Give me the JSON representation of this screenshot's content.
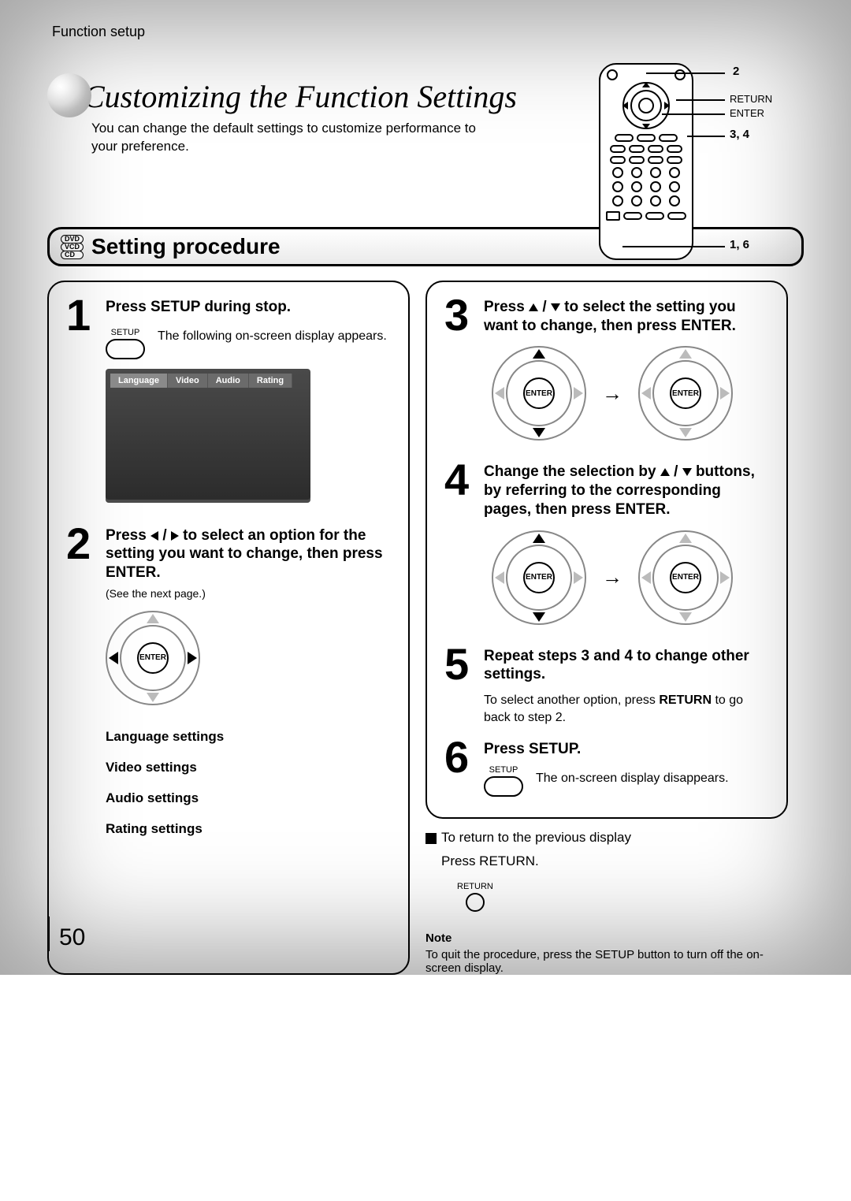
{
  "header": "Function setup",
  "title": "Customizing the Function Settings",
  "intro": "You can change the default settings to customize performance to your preference.",
  "remote_labels": {
    "l2": "2",
    "return": "RETURN",
    "enter": "ENTER",
    "l34": "3, 4",
    "l16": "1, 6"
  },
  "disc_badges": [
    "DVD",
    "VCD",
    "CD"
  ],
  "proc_title": "Setting procedure",
  "steps": {
    "s1": {
      "num": "1",
      "head": "Press SETUP during stop.",
      "setup_label": "SETUP",
      "desc": "The following on-screen display appears.",
      "tabs": [
        "Language",
        "Video",
        "Audio",
        "Rating"
      ]
    },
    "s2": {
      "num": "2",
      "head_pre": "Press ",
      "head_post": " to select an option for the setting you want to change, then press ENTER.",
      "seenext": "(See the next page.)",
      "enter": "ENTER",
      "settings": [
        "Language settings",
        "Video settings",
        "Audio settings",
        "Rating settings"
      ]
    },
    "s3": {
      "num": "3",
      "head_pre": "Press ",
      "head_post": " to select the setting you want to change, then press ENTER.",
      "enter": "ENTER"
    },
    "s4": {
      "num": "4",
      "head_pre": "Change the selection by ",
      "head_post": " buttons, by referring to the corresponding pages, then press ENTER.",
      "enter": "ENTER"
    },
    "s5": {
      "num": "5",
      "head": "Repeat steps 3 and 4 to change other settings.",
      "desc_a": "To select another option, press ",
      "return": "RETURN",
      "desc_b": " to go back to step 2."
    },
    "s6": {
      "num": "6",
      "head": "Press SETUP.",
      "setup_label": "SETUP",
      "desc": "The on-screen display disappears."
    }
  },
  "return_note": {
    "line1": "To return to the previous display",
    "line2": "Press RETURN.",
    "btn_label": "RETURN"
  },
  "note": {
    "title": "Note",
    "text": "To quit the procedure, press the SETUP button to turn off the on-screen display."
  },
  "page_number": "50"
}
